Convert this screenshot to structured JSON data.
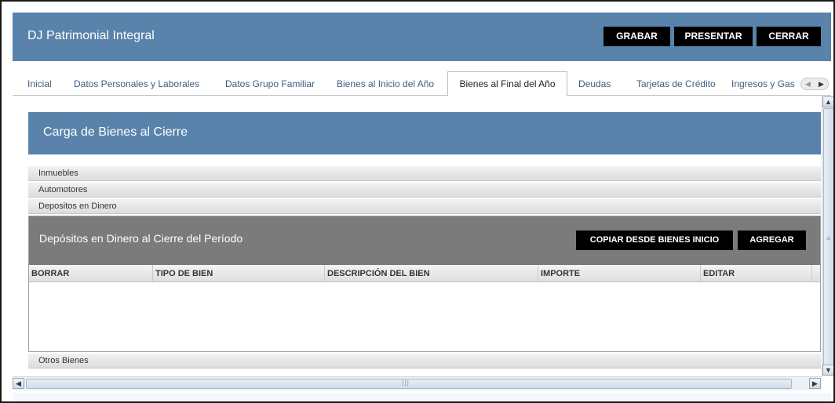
{
  "app": {
    "title": "DJ Patrimonial Integral",
    "buttons": {
      "grabar": "GRABAR",
      "presentar": "PRESENTAR",
      "cerrar": "CERRAR"
    }
  },
  "tabs": [
    {
      "label": "Inicial"
    },
    {
      "label": "Datos Personales y Laborales"
    },
    {
      "label": "Datos Grupo Familiar"
    },
    {
      "label": "Bienes al Inicio del Año"
    },
    {
      "label": "Bienes al Final del Año",
      "active": true
    },
    {
      "label": "Deudas"
    },
    {
      "label": "Tarjetas de Crédito"
    },
    {
      "label": "Ingresos y Gas"
    }
  ],
  "section": {
    "title": "Carga de Bienes al Cierre",
    "accordion": [
      "Inmuebles",
      "Automotores",
      "Depositos en Dinero"
    ],
    "footer_item": "Otros Bienes"
  },
  "deposits": {
    "title": "Depósitos en Dinero al Cierre del Período",
    "copy_button": "COPIAR DESDE BIENES INICIO",
    "add_button": "AGREGAR",
    "columns": [
      "BORRAR",
      "TIPO DE BIEN",
      "DESCRIPCIÓN DEL BIEN",
      "IMPORTE",
      "EDITAR"
    ],
    "rows": []
  },
  "icons": {
    "tab_scroll_left": "chevron-left-icon",
    "tab_scroll_right": "chevron-right-icon",
    "scroll_up": "arrow-up-icon",
    "scroll_down": "arrow-down-icon",
    "scroll_left": "arrow-left-icon",
    "scroll_right": "arrow-right-icon"
  },
  "colors": {
    "header_blue": "#5983aa",
    "panel_gray": "#7b7b7b",
    "button_black": "#000000",
    "tab_text": "#3f5f7f"
  }
}
